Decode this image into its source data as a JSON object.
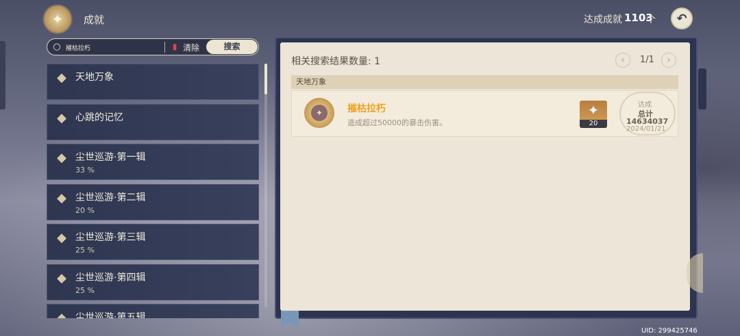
{
  "header": {
    "title": "成就",
    "total_label": "达成成就",
    "total_value": "1103",
    "total_unit": "个",
    "back_icon": "back-arrow-icon"
  },
  "search": {
    "value": "摧枯拉朽",
    "clear_label": "清除",
    "search_label": "搜索"
  },
  "categories": [
    {
      "name": "天地万象",
      "percent": ""
    },
    {
      "name": "心跳的记忆",
      "percent": ""
    },
    {
      "name": "尘世巡游·第一辑",
      "percent": "33 %"
    },
    {
      "name": "尘世巡游·第二辑",
      "percent": "20 %"
    },
    {
      "name": "尘世巡游·第三辑",
      "percent": "25 %"
    },
    {
      "name": "尘世巡游·第四辑",
      "percent": "25 %"
    },
    {
      "name": "尘世巡游·第五辑",
      "percent": ""
    }
  ],
  "results": {
    "count_label": "相关搜索结果数量: 1",
    "page": "1/1",
    "group": "天地万象",
    "item": {
      "name": "摧枯拉朽",
      "description": "造成超过50000的暴击伤害。",
      "reward_count": "20",
      "stamp_title": "达成",
      "stamp_label": "总计",
      "stamp_value": "14634037",
      "stamp_date": "2024/01/21"
    }
  },
  "uid": "UID: 299425746",
  "colors": {
    "accent_orange": "#f0a023",
    "panel_dark": "#2e3650",
    "paper": "#ece5d8",
    "clear_red": "#e04646"
  }
}
